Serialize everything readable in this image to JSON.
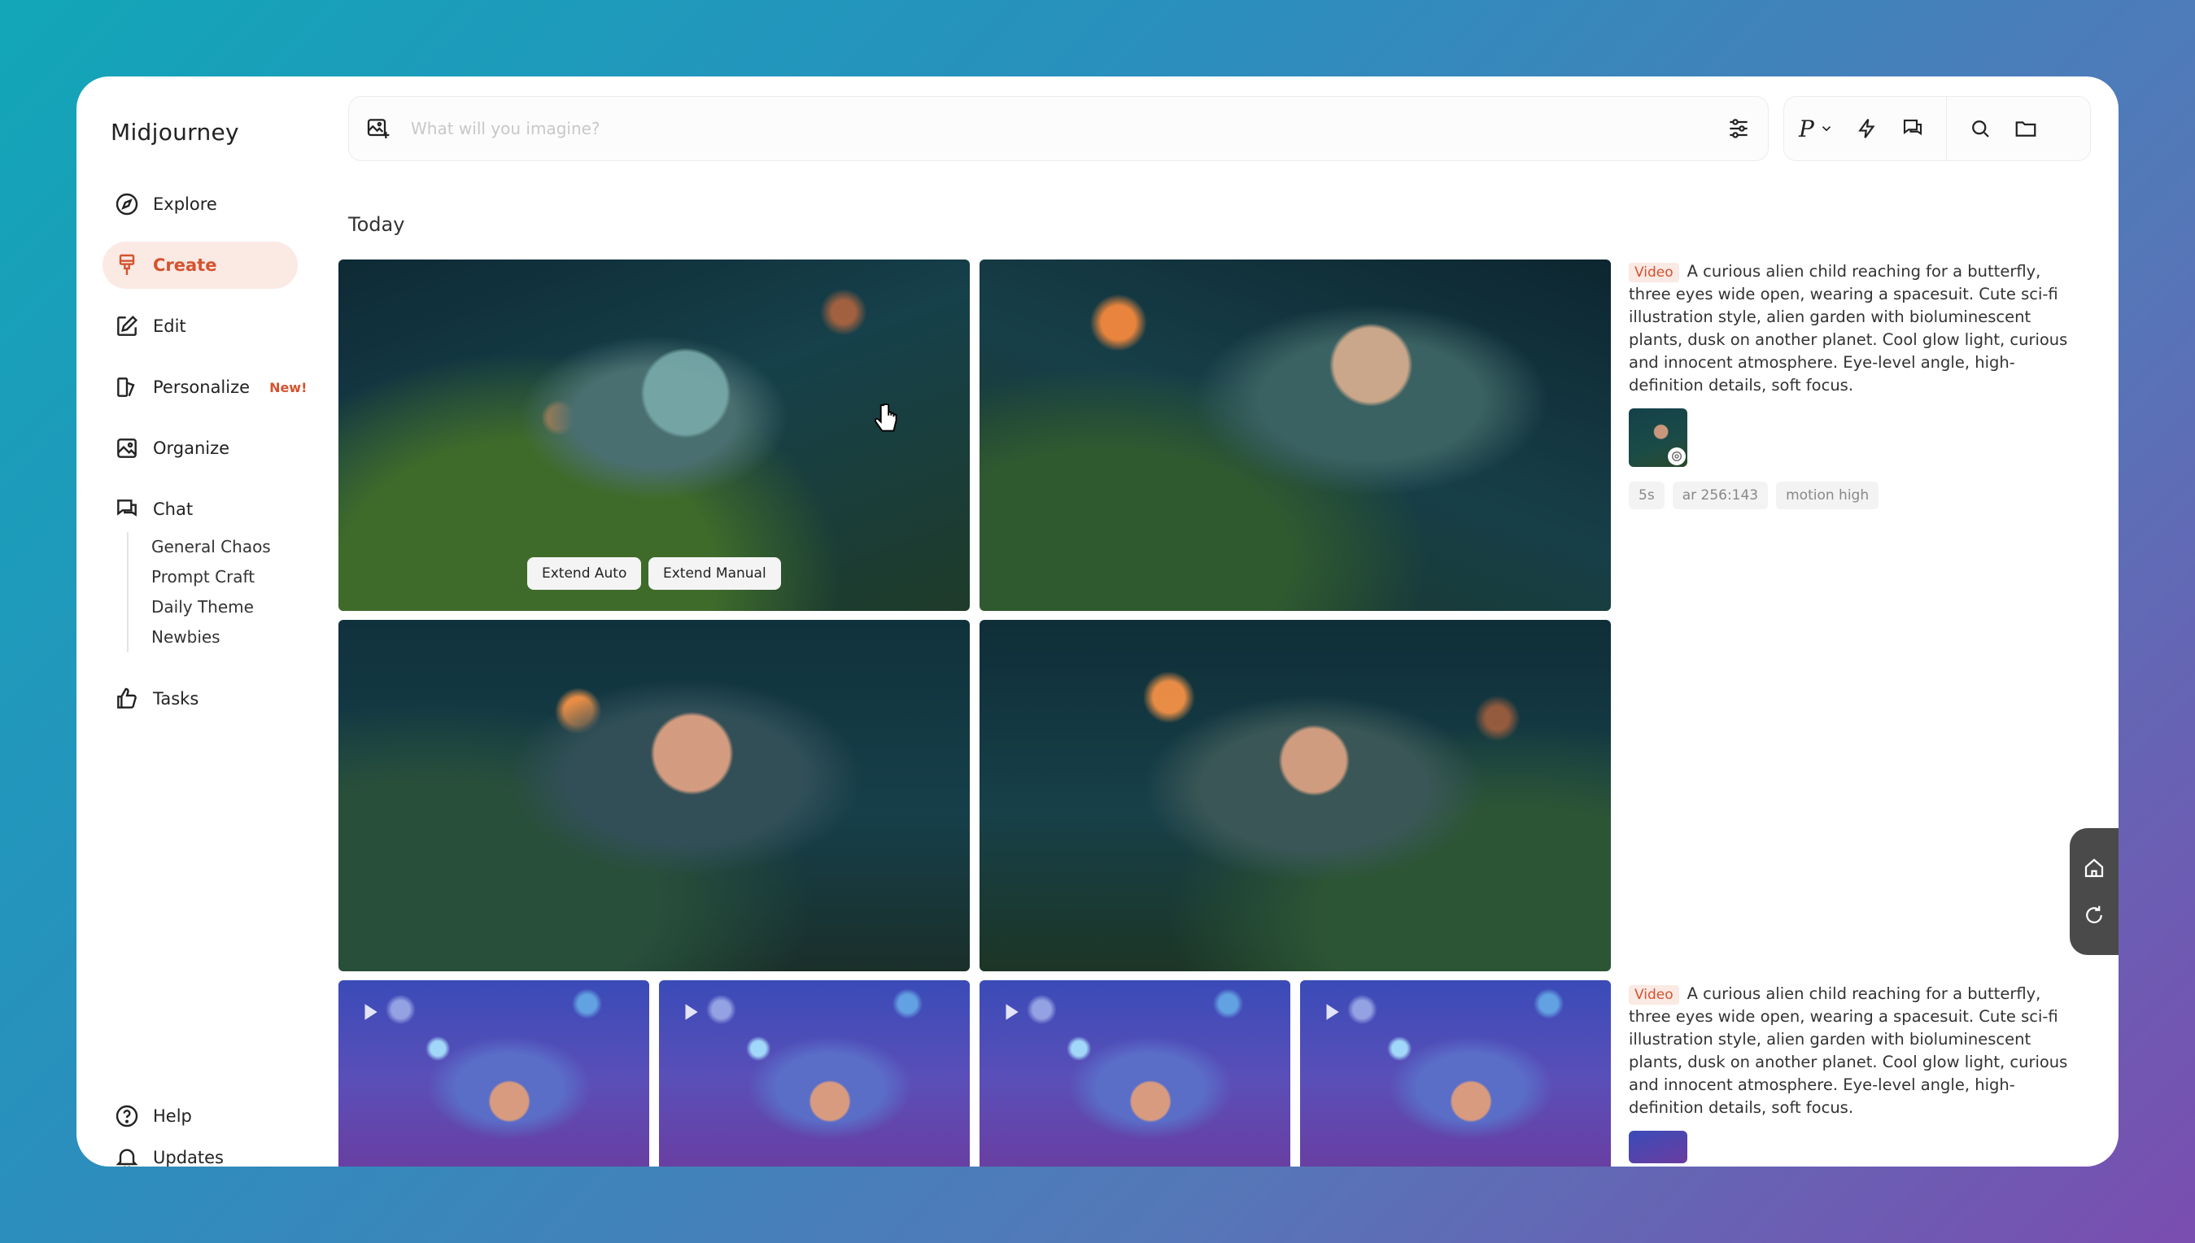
{
  "app": {
    "logo": "Midjourney"
  },
  "sidebar": {
    "items": [
      {
        "id": "explore",
        "label": "Explore",
        "icon": "compass-icon"
      },
      {
        "id": "create",
        "label": "Create",
        "icon": "brush-icon",
        "active": true
      },
      {
        "id": "edit",
        "label": "Edit",
        "icon": "edit-icon"
      },
      {
        "id": "personalize",
        "label": "Personalize",
        "icon": "personalize-icon",
        "badge": "New!"
      },
      {
        "id": "organize",
        "label": "Organize",
        "icon": "image-icon"
      },
      {
        "id": "chat",
        "label": "Chat",
        "icon": "chat-icon"
      },
      {
        "id": "tasks",
        "label": "Tasks",
        "icon": "thumbs-up-icon"
      }
    ],
    "chat_channels": [
      "General Chaos",
      "Prompt Craft",
      "Daily Theme",
      "Newbies"
    ],
    "footer": [
      {
        "label": "Help",
        "icon": "help-icon"
      },
      {
        "label": "Updates",
        "icon": "bell-icon"
      }
    ]
  },
  "search": {
    "placeholder": "What will you imagine?",
    "value": ""
  },
  "section": {
    "title": "Today"
  },
  "image_actions": {
    "extend_auto": "Extend Auto",
    "extend_manual": "Extend Manual"
  },
  "jobs": [
    {
      "tag": "Video",
      "prompt": "A curious alien child reaching for a butterfly, three eyes wide open, wearing a spacesuit. Cute sci-fi illustration style, alien garden with bioluminescent plants, dusk on another planet. Cool glow light, curious and innocent atmosphere. Eye-level angle, high-definition details, soft focus.",
      "chips": [
        "5s",
        "ar 256:143",
        "motion high"
      ]
    },
    {
      "tag": "Video",
      "prompt": "A curious alien child reaching for a butterfly, three eyes wide open, wearing a spacesuit. Cute sci-fi illustration style, alien garden with bioluminescent plants, dusk on another planet. Cool glow light, curious and innocent atmosphere. Eye-level angle, high-definition details, soft focus."
    }
  ],
  "colors": {
    "accent": "#d4532f",
    "accent_bg": "#fbe9e4"
  }
}
